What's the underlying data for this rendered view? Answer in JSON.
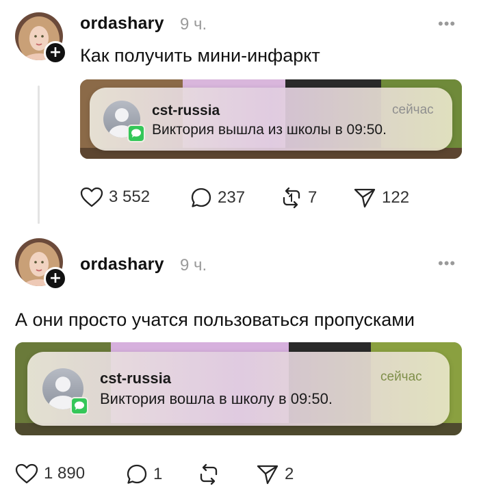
{
  "posts": [
    {
      "username": "ordashary",
      "time": "9 ч.",
      "more": "•••",
      "text": "Как получить мини-инфаркт",
      "notification": {
        "sender": "cst-russia",
        "time": "сейчас",
        "message": "Виктория вышла из школы в 09:50."
      },
      "actions": {
        "likes": "3 552",
        "replies": "237",
        "reposts": "7",
        "shares": "122"
      }
    },
    {
      "username": "ordashary",
      "time": "9 ч.",
      "more": "•••",
      "text": "А они просто учатся пользоваться пропусками",
      "notification": {
        "sender": "cst-russia",
        "time": "сейчас",
        "message": "Виктория вошла в школу в 09:50."
      },
      "actions": {
        "likes": "1 890",
        "replies": "1",
        "reposts": "",
        "shares": "2"
      }
    }
  ],
  "colors": {
    "notif_green": "#34c759",
    "muted": "#9a9a9a"
  },
  "icons": [
    "heart-icon",
    "comment-icon",
    "repost-icon",
    "send-icon",
    "plus-icon",
    "messages-icon"
  ]
}
